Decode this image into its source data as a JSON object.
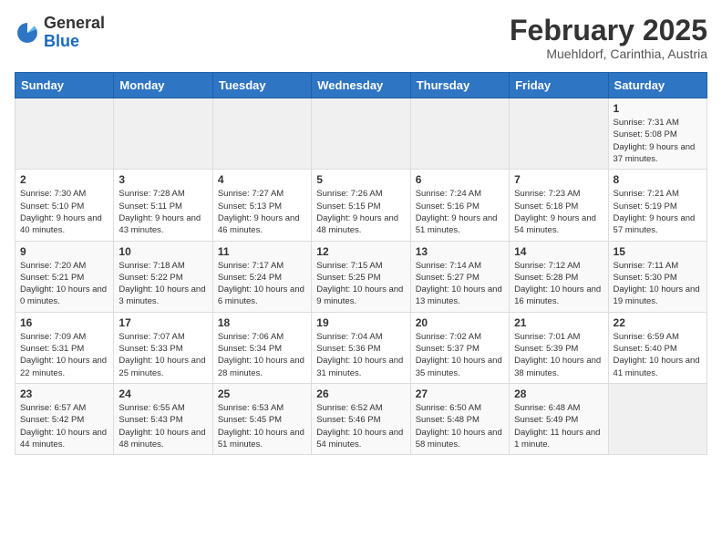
{
  "header": {
    "logo_general": "General",
    "logo_blue": "Blue",
    "month_title": "February 2025",
    "location": "Muehldorf, Carinthia, Austria"
  },
  "days_of_week": [
    "Sunday",
    "Monday",
    "Tuesday",
    "Wednesday",
    "Thursday",
    "Friday",
    "Saturday"
  ],
  "weeks": [
    [
      {
        "day": null,
        "info": null
      },
      {
        "day": null,
        "info": null
      },
      {
        "day": null,
        "info": null
      },
      {
        "day": null,
        "info": null
      },
      {
        "day": null,
        "info": null
      },
      {
        "day": null,
        "info": null
      },
      {
        "day": "1",
        "info": "Sunrise: 7:31 AM\nSunset: 5:08 PM\nDaylight: 9 hours and 37 minutes."
      }
    ],
    [
      {
        "day": "2",
        "info": "Sunrise: 7:30 AM\nSunset: 5:10 PM\nDaylight: 9 hours and 40 minutes."
      },
      {
        "day": "3",
        "info": "Sunrise: 7:28 AM\nSunset: 5:11 PM\nDaylight: 9 hours and 43 minutes."
      },
      {
        "day": "4",
        "info": "Sunrise: 7:27 AM\nSunset: 5:13 PM\nDaylight: 9 hours and 46 minutes."
      },
      {
        "day": "5",
        "info": "Sunrise: 7:26 AM\nSunset: 5:15 PM\nDaylight: 9 hours and 48 minutes."
      },
      {
        "day": "6",
        "info": "Sunrise: 7:24 AM\nSunset: 5:16 PM\nDaylight: 9 hours and 51 minutes."
      },
      {
        "day": "7",
        "info": "Sunrise: 7:23 AM\nSunset: 5:18 PM\nDaylight: 9 hours and 54 minutes."
      },
      {
        "day": "8",
        "info": "Sunrise: 7:21 AM\nSunset: 5:19 PM\nDaylight: 9 hours and 57 minutes."
      }
    ],
    [
      {
        "day": "9",
        "info": "Sunrise: 7:20 AM\nSunset: 5:21 PM\nDaylight: 10 hours and 0 minutes."
      },
      {
        "day": "10",
        "info": "Sunrise: 7:18 AM\nSunset: 5:22 PM\nDaylight: 10 hours and 3 minutes."
      },
      {
        "day": "11",
        "info": "Sunrise: 7:17 AM\nSunset: 5:24 PM\nDaylight: 10 hours and 6 minutes."
      },
      {
        "day": "12",
        "info": "Sunrise: 7:15 AM\nSunset: 5:25 PM\nDaylight: 10 hours and 9 minutes."
      },
      {
        "day": "13",
        "info": "Sunrise: 7:14 AM\nSunset: 5:27 PM\nDaylight: 10 hours and 13 minutes."
      },
      {
        "day": "14",
        "info": "Sunrise: 7:12 AM\nSunset: 5:28 PM\nDaylight: 10 hours and 16 minutes."
      },
      {
        "day": "15",
        "info": "Sunrise: 7:11 AM\nSunset: 5:30 PM\nDaylight: 10 hours and 19 minutes."
      }
    ],
    [
      {
        "day": "16",
        "info": "Sunrise: 7:09 AM\nSunset: 5:31 PM\nDaylight: 10 hours and 22 minutes."
      },
      {
        "day": "17",
        "info": "Sunrise: 7:07 AM\nSunset: 5:33 PM\nDaylight: 10 hours and 25 minutes."
      },
      {
        "day": "18",
        "info": "Sunrise: 7:06 AM\nSunset: 5:34 PM\nDaylight: 10 hours and 28 minutes."
      },
      {
        "day": "19",
        "info": "Sunrise: 7:04 AM\nSunset: 5:36 PM\nDaylight: 10 hours and 31 minutes."
      },
      {
        "day": "20",
        "info": "Sunrise: 7:02 AM\nSunset: 5:37 PM\nDaylight: 10 hours and 35 minutes."
      },
      {
        "day": "21",
        "info": "Sunrise: 7:01 AM\nSunset: 5:39 PM\nDaylight: 10 hours and 38 minutes."
      },
      {
        "day": "22",
        "info": "Sunrise: 6:59 AM\nSunset: 5:40 PM\nDaylight: 10 hours and 41 minutes."
      }
    ],
    [
      {
        "day": "23",
        "info": "Sunrise: 6:57 AM\nSunset: 5:42 PM\nDaylight: 10 hours and 44 minutes."
      },
      {
        "day": "24",
        "info": "Sunrise: 6:55 AM\nSunset: 5:43 PM\nDaylight: 10 hours and 48 minutes."
      },
      {
        "day": "25",
        "info": "Sunrise: 6:53 AM\nSunset: 5:45 PM\nDaylight: 10 hours and 51 minutes."
      },
      {
        "day": "26",
        "info": "Sunrise: 6:52 AM\nSunset: 5:46 PM\nDaylight: 10 hours and 54 minutes."
      },
      {
        "day": "27",
        "info": "Sunrise: 6:50 AM\nSunset: 5:48 PM\nDaylight: 10 hours and 58 minutes."
      },
      {
        "day": "28",
        "info": "Sunrise: 6:48 AM\nSunset: 5:49 PM\nDaylight: 11 hours and 1 minute."
      },
      {
        "day": null,
        "info": null
      }
    ]
  ]
}
